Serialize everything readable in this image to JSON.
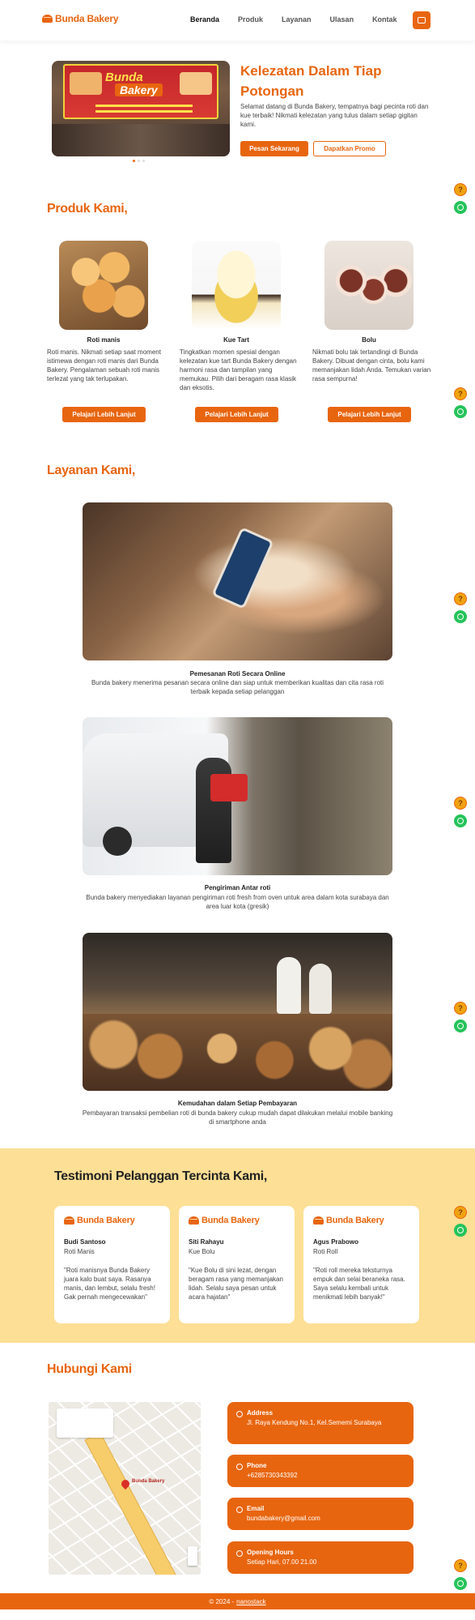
{
  "brand": {
    "name": "Bunda Bakery",
    "accent": "#e8650f",
    "cream": "#fddf95"
  },
  "nav": {
    "items": [
      {
        "label": "Beranda",
        "active": true
      },
      {
        "label": "Produk",
        "active": false
      },
      {
        "label": "Layanan",
        "active": false
      },
      {
        "label": "Ulasan",
        "active": false
      },
      {
        "label": "Kontak",
        "active": false
      }
    ],
    "cart_icon": "shop-icon"
  },
  "hero": {
    "banner_title": "Bunda",
    "banner_subtitle": "Bakery",
    "title": "Kelezatan Dalam Tiap Potongan",
    "text": "Selamat datang di Bunda Bakery, tempatnya bagi pecinta roti dan kue terbaik! Nikmati kelezatan yang tulus dalam setiap gigitan kami.",
    "primary_button": "Pesan Sekarang",
    "secondary_button": "Dapatkan Promo",
    "carousel_active": 1
  },
  "products": {
    "title": "Produk Kami,",
    "items": [
      {
        "name": "Roti manis",
        "desc": "Roti manis. Nikmati setiap saat moment istimewa dengan roti manis dari Bunda Bakery. Pengalaman sebuah roti manis terlezat yang tak terlupakan.",
        "button": "Pelajari Lebih Lanjut"
      },
      {
        "name": "Kue Tart",
        "desc": "Tingkatkan momen spesial dengan kelezatan kue tart Bunda Bakery dengan harmoni rasa dan tampilan yang memukau. Pilih dari beragam rasa klasik dan eksotis.",
        "button": "Pelajari Lebih Lanjut"
      },
      {
        "name": "Bolu",
        "desc": "Nikmati bolu tak tertandingi di Bunda Bakery. Dibuat dengan cinta, bolu kami memanjakan lidah Anda. Temukan varian rasa sempurna!",
        "button": "Pelajari Lebih Lanjut"
      }
    ]
  },
  "services": {
    "title": "Layanan Kami,",
    "items": [
      {
        "title": "Pemesanan Roti Secara Online",
        "desc": "Bunda bakery menerima pesanan secara online dan siap untuk memberikan kualitas dan cita rasa roti terbaik kepada setiap pelanggan"
      },
      {
        "title": "Pengiriman Antar roti",
        "desc": "Bunda bakery menyediakan layanan pengiriman roti fresh from oven untuk area dalam kota surabaya dan area luar kota (gresik)"
      },
      {
        "title": "Kemudahan dalam Setiap Pembayaran",
        "desc": "Pembayaran transaksi pembelian roti di bunda bakery cukup mudah dapat dilakukan melalui mobile banking di smartphone anda"
      }
    ]
  },
  "testimonials": {
    "title": "Testimoni Pelanggan Tercinta Kami,",
    "items": [
      {
        "name": "Budi Santoso",
        "product": "Roti Manis",
        "quote": "\"Roti manisnya Bunda Bakery juara kalo buat saya. Rasanya manis, dan lembut, selalu fresh! Gak pernah mengecewakan\""
      },
      {
        "name": "Siti Rahayu",
        "product": "Kue Bolu",
        "quote": "\"Kue Bolu di sini lezat, dengan beragam rasa yang memanjakan lidah. Selalu saya pesan untuk acara hajatan\""
      },
      {
        "name": "Agus Prabowo",
        "product": "Roti Roll",
        "quote": "\"Roti roll mereka teksturnya empuk dan selai beraneka rasa. Saya selalu kembali untuk menikmati lebih banyak!\""
      }
    ]
  },
  "contact": {
    "title": "Hubungi Kami",
    "map_label": "Bunda Bakery",
    "items": [
      {
        "label": "Address",
        "value": "Jl. Raya Kendung No.1, Kel.Sememi Surabaya",
        "icon": "location-icon"
      },
      {
        "label": "Phone",
        "value": "+6285730343392",
        "icon": "phone-icon"
      },
      {
        "label": "Email",
        "value": "bundabakery@gmail.com",
        "icon": "mail-icon"
      },
      {
        "label": "Opening Hours",
        "value": "Setiap Hari, 07.00 21.00",
        "icon": "clock-icon"
      }
    ]
  },
  "footer": {
    "text": "© 2024 -",
    "link": "nanostack"
  },
  "floating": {
    "help_icon": "help-icon",
    "whatsapp_icon": "whatsapp-icon",
    "help_glyph": "?"
  }
}
